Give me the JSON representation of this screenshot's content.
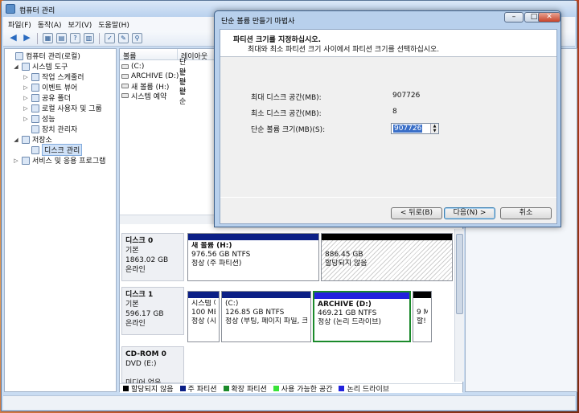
{
  "window": {
    "title": "컴퓨터 관리",
    "controls": [
      "–",
      "□",
      "✕"
    ]
  },
  "menu": [
    "파일(F)",
    "동작(A)",
    "보기(V)",
    "도움말(H)"
  ],
  "toolbar": {
    "back": "◀",
    "forward": "▶",
    "tools": [
      "▦",
      "▤",
      "?",
      "▥",
      "✓",
      "✎",
      "⚲"
    ]
  },
  "tree": [
    {
      "label": "컴퓨터 관리(로컬)",
      "indent": 0,
      "expander": ""
    },
    {
      "label": "시스템 도구",
      "indent": 1,
      "expander": "◢"
    },
    {
      "label": "작업 스케줄러",
      "indent": 2,
      "expander": "▷"
    },
    {
      "label": "이벤트 뷰어",
      "indent": 2,
      "expander": "▷"
    },
    {
      "label": "공유 폴더",
      "indent": 2,
      "expander": "▷"
    },
    {
      "label": "로컬 사용자 및 그룹",
      "indent": 2,
      "expander": "▷"
    },
    {
      "label": "성능",
      "indent": 2,
      "expander": "▷"
    },
    {
      "label": "장치 관리자",
      "indent": 2,
      "expander": ""
    },
    {
      "label": "저장소",
      "indent": 1,
      "expander": "◢"
    },
    {
      "label": "디스크 관리",
      "indent": 2,
      "expander": "",
      "selected": true
    },
    {
      "label": "서비스 및 응용 프로그램",
      "indent": 1,
      "expander": "▷"
    }
  ],
  "list": {
    "headers": [
      "볼륨",
      "레이아웃"
    ],
    "rows": [
      [
        "(C:)",
        "단순"
      ],
      [
        "ARCHIVE (D:)",
        "단순"
      ],
      [
        "새 볼륨 (H:)",
        "단순"
      ],
      [
        "시스템 예약",
        "단순"
      ]
    ]
  },
  "disks": [
    {
      "name": "디스크 0",
      "type": "기본",
      "size": "1863.02 GB",
      "status": "온라인"
    },
    {
      "name": "디스크 1",
      "type": "기본",
      "size": "596.17 GB",
      "status": "온라인"
    },
    {
      "name": "CD-ROM 0",
      "type": "DVD (E:)",
      "size": "",
      "status": "미디어 없음"
    }
  ],
  "partitions": {
    "d0p1": {
      "name": "새 볼륨  (H:)",
      "size": "976.56 GB NTFS",
      "status": "정상 (주 파티션)"
    },
    "d0p2": {
      "name": "",
      "size": "886.45 GB",
      "status": "할당되지 않음"
    },
    "d1p1": {
      "name": "시스템 예",
      "size": "100 MB",
      "status": "정상 (시"
    },
    "d1p2": {
      "name": "(C:)",
      "size": "126.85 GB NTFS",
      "status": "정상 (부팅, 페이지 파일, 크"
    },
    "d1p3": {
      "name": "ARCHIVE  (D:)",
      "size": "469.21 GB NTFS",
      "status": "정상 (논리 드라이브)"
    },
    "d1p4": {
      "name": "",
      "size": "9 M",
      "status": "할!"
    }
  },
  "legend": [
    {
      "label": "할당되지 않음",
      "color": "#000000"
    },
    {
      "label": "주 파티션",
      "color": "#0b1f86"
    },
    {
      "label": "확장 파티션",
      "color": "#1b8a2b"
    },
    {
      "label": "사용 가능한 공간",
      "color": "#39e339"
    },
    {
      "label": "논리 드라이브",
      "color": "#2222dd"
    }
  ],
  "wizard": {
    "title": "단순 볼륨 만들기 마법사",
    "heading": "파티션 크기를 지정하십시오.",
    "subheading": "최대와 최소 파티션 크기 사이에서 파티션 크기를 선택하십시오.",
    "fields": [
      {
        "label": "최대 디스크 공간(MB):",
        "value": "907726"
      },
      {
        "label": "최소 디스크 공간(MB):",
        "value": "8"
      }
    ],
    "size_label": "단순 볼륨 크기(MB)(S):",
    "size_value": "907726",
    "back": "< 뒤로(B)",
    "next": "다음(N) >",
    "cancel": "취소"
  }
}
